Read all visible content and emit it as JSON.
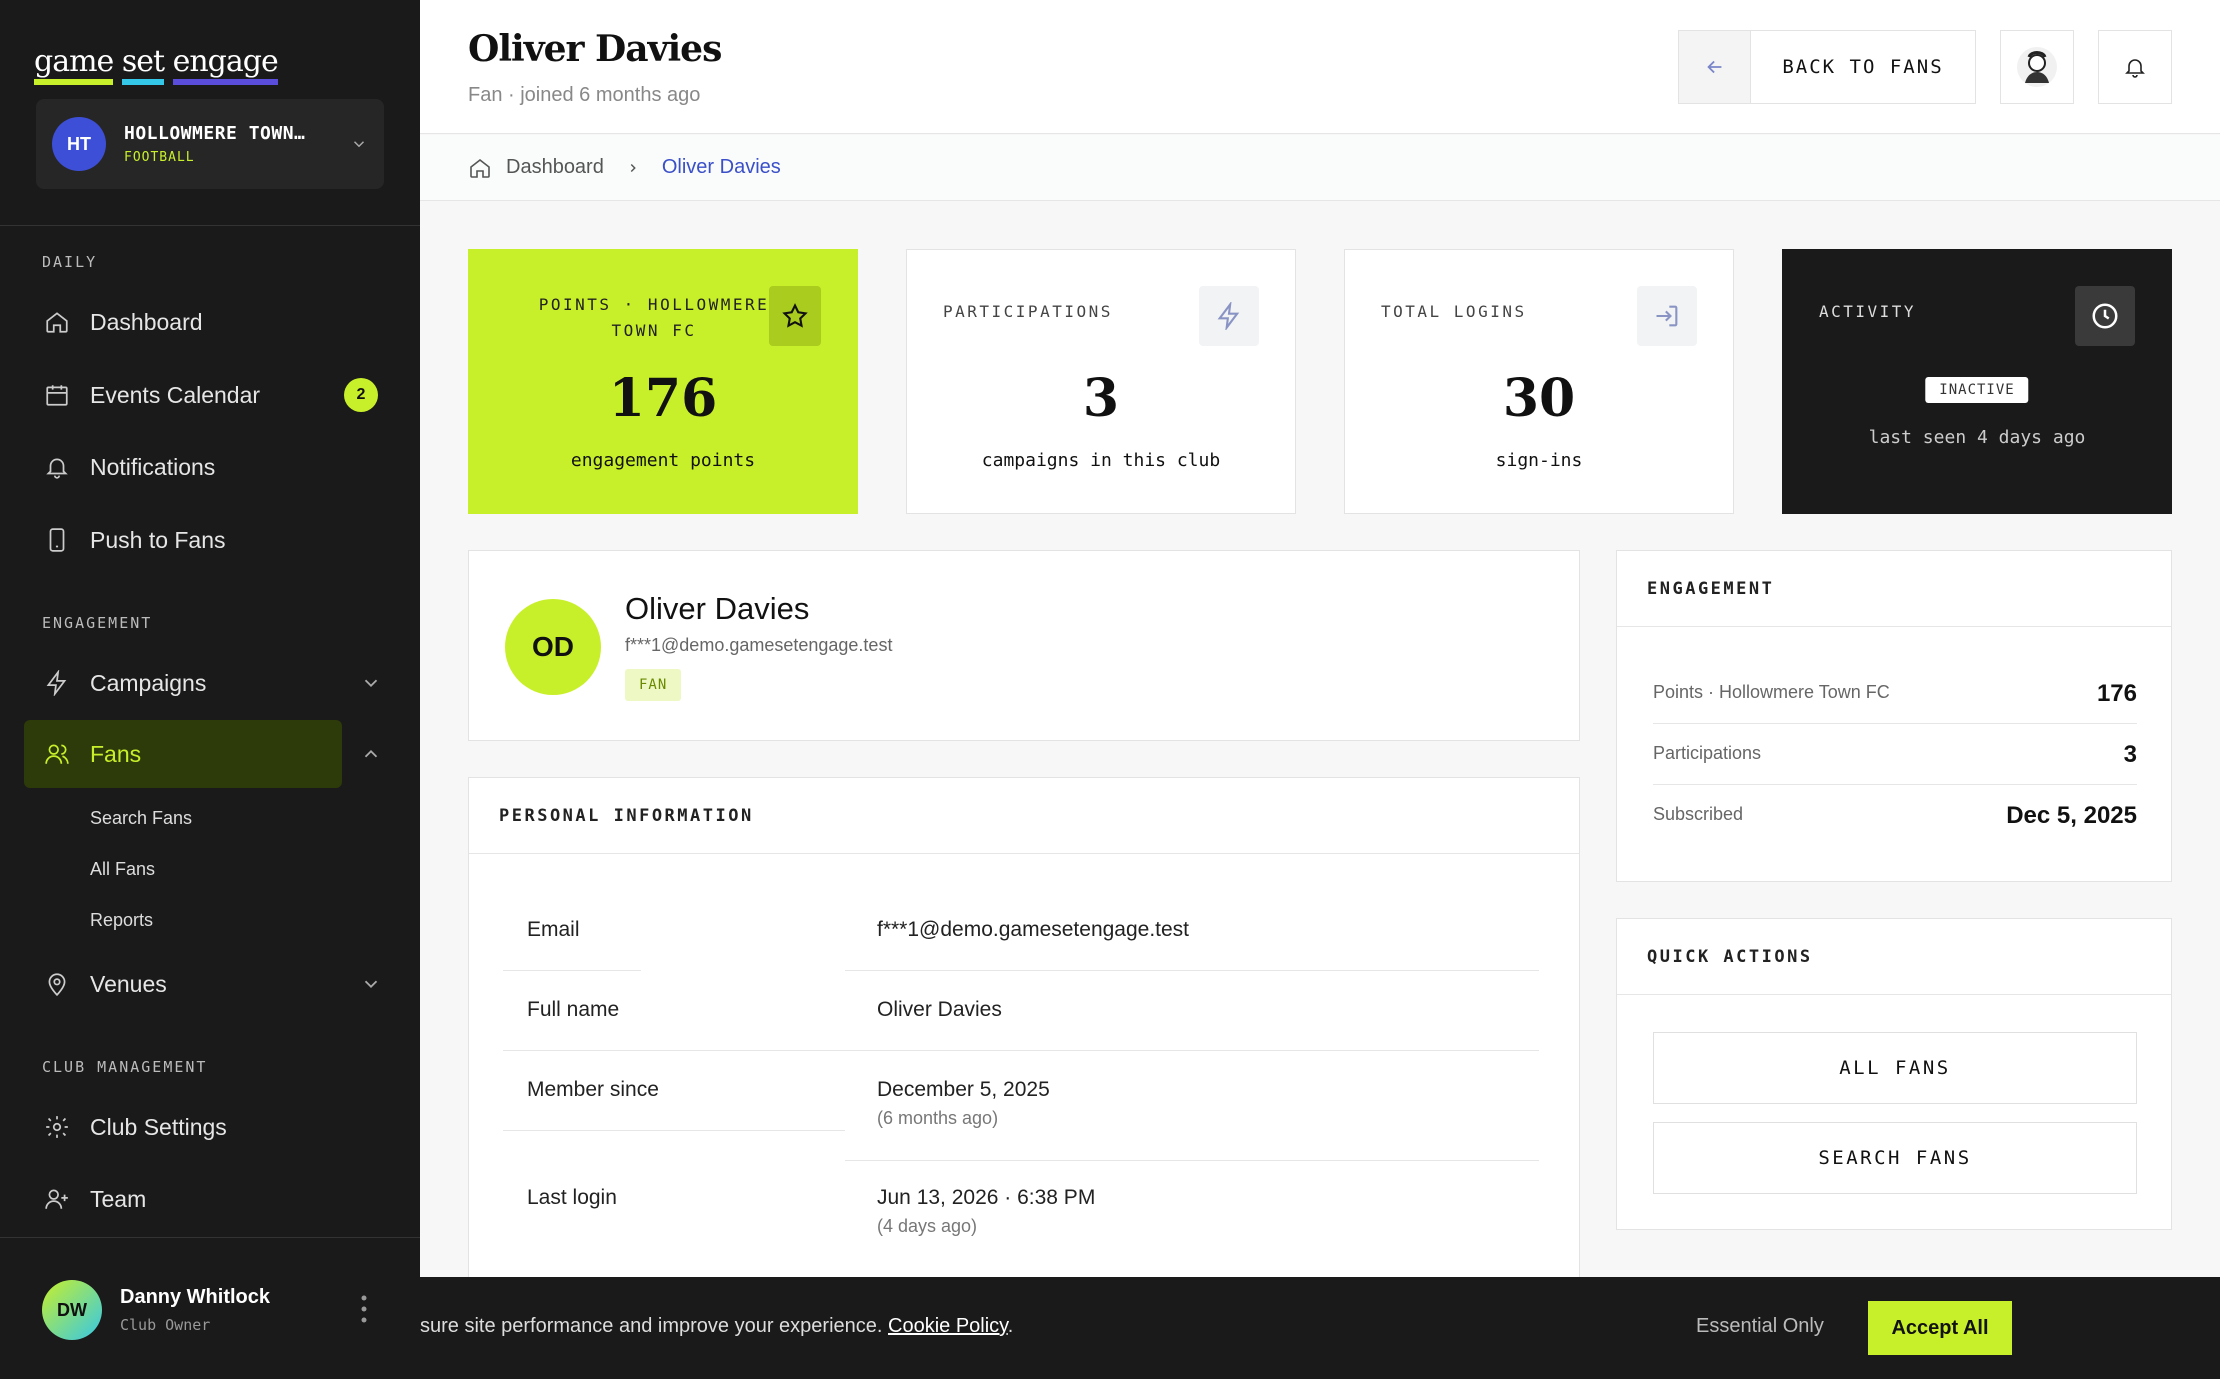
{
  "brand": {
    "logo_text": [
      "game",
      "set",
      "engage"
    ]
  },
  "club": {
    "initials": "HT",
    "name": "HOLLOWMERE TOWN…",
    "type": "FOOTBALL"
  },
  "sidebar": {
    "sections": {
      "daily": "DAILY",
      "engagement": "ENGAGEMENT",
      "club_management": "CLUB MANAGEMENT"
    },
    "items": {
      "dashboard": "Dashboard",
      "events": "Events Calendar",
      "events_badge": "2",
      "notifications": "Notifications",
      "push": "Push to Fans",
      "campaigns": "Campaigns",
      "fans": "Fans",
      "search_fans": "Search Fans",
      "all_fans": "All Fans",
      "reports": "Reports",
      "venues": "Venues",
      "club_settings": "Club Settings",
      "team": "Team"
    },
    "user": {
      "initials": "DW",
      "name": "Danny Whitlock",
      "role": "Club Owner"
    }
  },
  "header": {
    "title": "Oliver Davies",
    "subtitle": "Fan · joined 6 months ago",
    "back_label": "BACK TO FANS"
  },
  "breadcrumb": {
    "home": "Dashboard",
    "current": "Oliver Davies"
  },
  "stats": {
    "points": {
      "label": "POINTS · HOLLOWMERE TOWN FC",
      "value": "176",
      "caption": "engagement points",
      "icon": "star-icon"
    },
    "participations": {
      "label": "PARTICIPATIONS",
      "value": "3",
      "caption": "campaigns in this club",
      "icon": "lightning-icon"
    },
    "logins": {
      "label": "TOTAL LOGINS",
      "value": "30",
      "caption": "sign-ins",
      "icon": "login-icon"
    },
    "activity": {
      "label": "ACTIVITY",
      "status": "INACTIVE",
      "caption": "last seen 4 days ago",
      "icon": "clock-icon"
    }
  },
  "profile": {
    "initials": "OD",
    "name": "Oliver Davies",
    "email": "f***1@demo.gamesetengage.test",
    "role_badge": "FAN"
  },
  "personal_info": {
    "title": "PERSONAL INFORMATION",
    "rows": [
      {
        "key": "Email",
        "value": "f***1@demo.gamesetengage.test",
        "sub": ""
      },
      {
        "key": "Full name",
        "value": "Oliver Davies",
        "sub": ""
      },
      {
        "key": "Member since",
        "value": "December 5, 2025",
        "sub": "(6 months ago)"
      },
      {
        "key": "Last login",
        "value": "Jun 13, 2026 · 6:38 PM",
        "sub": "(4 days ago)"
      }
    ]
  },
  "engagement": {
    "title": "ENGAGEMENT",
    "rows": [
      {
        "key": "Points · Hollowmere Town FC",
        "value": "176"
      },
      {
        "key": "Participations",
        "value": "3"
      },
      {
        "key": "Subscribed",
        "value": "Dec 5, 2025"
      }
    ]
  },
  "quick_actions": {
    "title": "QUICK ACTIONS",
    "all_fans": "ALL FANS",
    "search_fans": "SEARCH FANS"
  },
  "cookie": {
    "text": "sure site performance and improve your experience.",
    "link": "Cookie Policy",
    "period": ".",
    "essential": "Essential Only",
    "accept": "Accept All"
  },
  "colors": {
    "accent": "#c8f02a",
    "sidebar": "#1a1a1a",
    "link": "#3a4fc8",
    "club_avatar": "#3d4fd6"
  }
}
